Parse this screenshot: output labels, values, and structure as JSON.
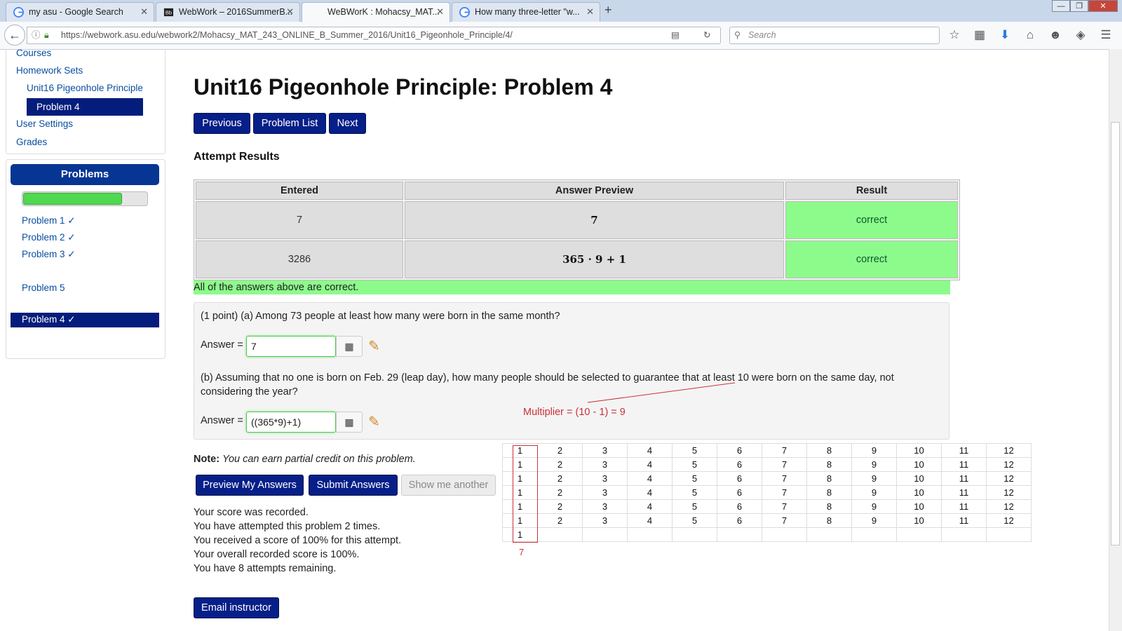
{
  "browser": {
    "tabs": [
      {
        "title": "my asu - Google Search",
        "icon": "google-icon",
        "active": false
      },
      {
        "title": "WebWork – 2016SummerB...",
        "icon": "blackboard-icon",
        "active": false
      },
      {
        "title": "WeBWorK : Mohacsy_MAT...",
        "icon": "none",
        "active": true
      },
      {
        "title": "How many three-letter \"w...",
        "icon": "google-icon",
        "active": false
      }
    ],
    "url": "https://webwork.asu.edu/webwork2/Mohacsy_MAT_243_ONLINE_B_Summer_2016/Unit16_Pigeonhole_Principle/4/",
    "search_placeholder": "Search"
  },
  "sidebar": {
    "links": [
      "Courses",
      "Homework Sets",
      "Unit16 Pigeonhole Principle",
      "Problem 4",
      "User Settings",
      "Grades"
    ],
    "problems_heading": "Problems",
    "progress_fraction": 0.8,
    "problems": [
      "Problem 1 ✓",
      "Problem 2 ✓",
      "Problem 3 ✓",
      "Problem 4 ✓",
      "Problem 5"
    ],
    "active_problem_index": 3
  },
  "main": {
    "title": "Unit16 Pigeonhole Principle: Problem 4",
    "nav_buttons": [
      "Previous",
      "Problem List",
      "Next"
    ],
    "attempt_heading": "Attempt Results",
    "results_headers": [
      "Entered",
      "Answer Preview",
      "Result"
    ],
    "results_rows": [
      {
        "entered": "7",
        "preview": "7",
        "result": "correct"
      },
      {
        "entered": "3286",
        "preview": "365 · 9 + 1",
        "result": "correct"
      }
    ],
    "all_correct_msg": "All of the answers above are correct.",
    "problem": {
      "part_a": "(1 point) (a) Among 73 people at least how many were born in the same month?",
      "answer_label": "Answer =",
      "answer_a": "7",
      "part_b": "(b) Assuming that no one is born on Feb. 29 (leap day), how many people should be selected to guarantee that at least 10 were born on the same day, not considering the year?",
      "answer_b": "((365*9)+1)"
    },
    "annotation_multiplier": "Multiplier = (10 - 1) = 9",
    "note_bold": "Note:",
    "note_text": "You can earn partial credit on this problem.",
    "action_buttons": [
      "Preview My Answers",
      "Submit Answers",
      "Show me another"
    ],
    "status_lines": [
      "Your score was recorded.",
      "You have attempted this problem 2 times.",
      "You received a score of 100% for this attempt.",
      "Your overall recorded score is 100%.",
      "You have 8 attempts remaining."
    ],
    "email_button": "Email instructor"
  },
  "month_grid": {
    "months": [
      "1",
      "2",
      "3",
      "4",
      "5",
      "6",
      "7",
      "8",
      "9",
      "10",
      "11",
      "12"
    ],
    "full_rows": 6,
    "extra_row_first": "1",
    "count_label": "7"
  },
  "colors": {
    "accent": "#061f89",
    "correct_green": "#8dfb8b",
    "annotation_red": "#c8323a"
  }
}
